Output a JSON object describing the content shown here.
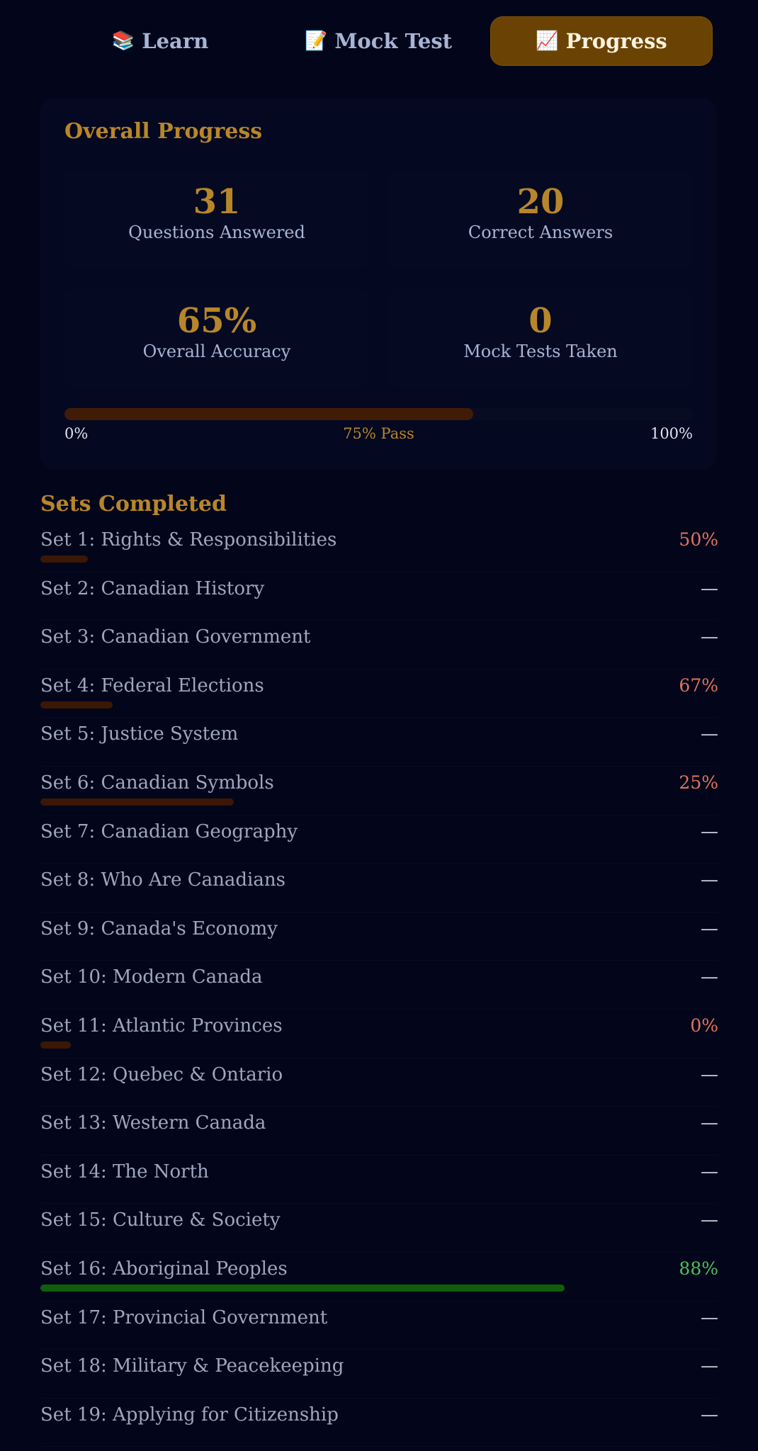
{
  "tabs": {
    "learn": {
      "icon": "📚",
      "label": "Learn"
    },
    "mock": {
      "icon": "📝",
      "label": "Mock Test"
    },
    "progress": {
      "icon": "📈",
      "label": "Progress"
    }
  },
  "overall": {
    "title": "Overall Progress",
    "stats": [
      {
        "value": "31",
        "label": "Questions Answered"
      },
      {
        "value": "20",
        "label": "Correct Answers"
      },
      {
        "value": "65%",
        "label": "Overall Accuracy"
      },
      {
        "value": "0",
        "label": "Mock Tests Taken"
      }
    ],
    "progress_fraction": 0.65,
    "bar_labels": {
      "start": "0%",
      "pass": "75% Pass",
      "end": "100%"
    }
  },
  "sets": {
    "title": "Sets Completed",
    "items": [
      {
        "name": "Set 1: Rights & Responsibilities",
        "score": "50%",
        "fraction": 0.07,
        "status": "low"
      },
      {
        "name": "Set 2: Canadian History",
        "score": "—",
        "fraction": null,
        "status": "none"
      },
      {
        "name": "Set 3: Canadian Government",
        "score": "—",
        "fraction": null,
        "status": "none"
      },
      {
        "name": "Set 4: Federal Elections",
        "score": "67%",
        "fraction": 0.107,
        "status": "low"
      },
      {
        "name": "Set 5: Justice System",
        "score": "—",
        "fraction": null,
        "status": "none"
      },
      {
        "name": "Set 6: Canadian Symbols",
        "score": "25%",
        "fraction": 0.286,
        "status": "low"
      },
      {
        "name": "Set 7: Canadian Geography",
        "score": "—",
        "fraction": null,
        "status": "none"
      },
      {
        "name": "Set 8: Who Are Canadians",
        "score": "—",
        "fraction": null,
        "status": "none"
      },
      {
        "name": "Set 9: Canada's Economy",
        "score": "—",
        "fraction": null,
        "status": "none"
      },
      {
        "name": "Set 10: Modern Canada",
        "score": "—",
        "fraction": null,
        "status": "none"
      },
      {
        "name": "Set 11: Atlantic Provinces",
        "score": "0%",
        "fraction": 0.045,
        "status": "low"
      },
      {
        "name": "Set 12: Quebec & Ontario",
        "score": "—",
        "fraction": null,
        "status": "none"
      },
      {
        "name": "Set 13: Western Canada",
        "score": "—",
        "fraction": null,
        "status": "none"
      },
      {
        "name": "Set 14: The North",
        "score": "—",
        "fraction": null,
        "status": "none"
      },
      {
        "name": "Set 15: Culture & Society",
        "score": "—",
        "fraction": null,
        "status": "none"
      },
      {
        "name": "Set 16: Aboriginal Peoples",
        "score": "88%",
        "fraction": 0.775,
        "status": "high"
      },
      {
        "name": "Set 17: Provincial Government",
        "score": "—",
        "fraction": null,
        "status": "none"
      },
      {
        "name": "Set 18: Military & Peacekeeping",
        "score": "—",
        "fraction": null,
        "status": "none"
      },
      {
        "name": "Set 19: Applying for Citizenship",
        "score": "—",
        "fraction": null,
        "status": "none"
      }
    ]
  },
  "colors": {
    "background": "#03061a",
    "accent_gold": "#b8862a",
    "active_tab": "#6a4304",
    "low_score": "#e2735f",
    "high_score": "#4fbf5a"
  }
}
